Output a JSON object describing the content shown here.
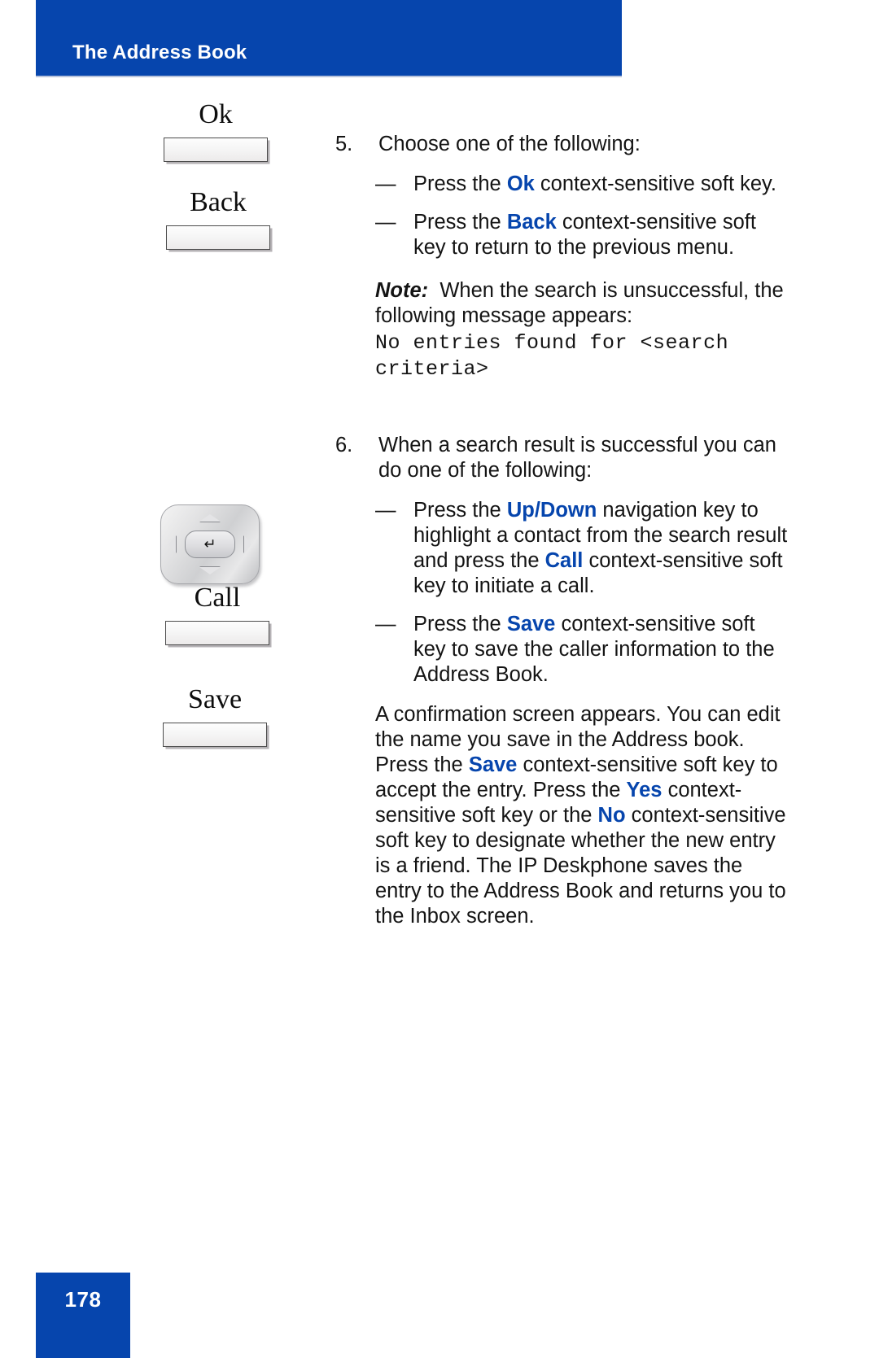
{
  "header": {
    "title": "The Address Book"
  },
  "footer": {
    "page_number": "178"
  },
  "colors": {
    "brand_blue": "#0645AD",
    "keyword_blue": "#0645AD",
    "page_background": "#FFFFFF"
  },
  "graphics": {
    "softkeys": [
      {
        "name": "ok-softkey",
        "label": "Ok"
      },
      {
        "name": "back-softkey",
        "label": "Back"
      },
      {
        "name": "call-softkey",
        "label": "Call"
      },
      {
        "name": "save-softkey",
        "label": "Save"
      }
    ],
    "navigation_cluster": {
      "name": "navigation-key-cluster",
      "enter_glyph": "↵",
      "arrows": [
        "up",
        "down",
        "left",
        "right"
      ]
    }
  },
  "content": {
    "step5": {
      "number": "5.",
      "text": "Choose one of the following:",
      "bullets": [
        {
          "dash": "—",
          "parts": [
            {
              "t": "Press the ",
              "style": "normal"
            },
            {
              "t": "Ok",
              "style": "keyword"
            },
            {
              "t": " context-sensitive soft key.",
              "style": "normal"
            }
          ]
        },
        {
          "dash": "—",
          "parts": [
            {
              "t": "Press the ",
              "style": "normal"
            },
            {
              "t": "Back",
              "style": "keyword"
            },
            {
              "t": " context-sensitive soft key to return to the previous menu.",
              "style": "normal"
            }
          ]
        }
      ],
      "note": {
        "label": "Note:",
        "text": "When the search is unsuccessful, the following message appears:",
        "message": "No entries found for <search criteria>"
      }
    },
    "step6": {
      "number": "6.",
      "text": "When a search result is successful you can do one of the following:",
      "bullets": [
        {
          "dash": "—",
          "parts": [
            {
              "t": "Press the ",
              "style": "normal"
            },
            {
              "t": "Up",
              "style": "keyword"
            },
            {
              "t": "/",
              "style": "keyword"
            },
            {
              "t": "Down",
              "style": "keyword"
            },
            {
              "t": " navigation key to highlight a contact from the search result and press the ",
              "style": "normal"
            },
            {
              "t": "Call",
              "style": "keyword"
            },
            {
              "t": " context-sensitive soft key to initiate a call.",
              "style": "normal"
            }
          ]
        },
        {
          "dash": "—",
          "parts": [
            {
              "t": "Press the ",
              "style": "normal"
            },
            {
              "t": "Save",
              "style": "keyword"
            },
            {
              "t": " context-sensitive soft key to save the caller information to the Address Book.",
              "style": "normal"
            }
          ]
        }
      ],
      "paragraph": [
        {
          "t": "A confirmation screen appears. You can edit the name you save in the Address book. Press the ",
          "style": "normal"
        },
        {
          "t": "Save",
          "style": "keyword"
        },
        {
          "t": " context-sensitive soft key to accept the entry. Press the ",
          "style": "normal"
        },
        {
          "t": "Yes",
          "style": "keyword"
        },
        {
          "t": " context-sensitive soft key or the ",
          "style": "normal"
        },
        {
          "t": "No",
          "style": "keyword"
        },
        {
          "t": " context-sensitive soft key to designate whether the new entry is a friend. The IP Deskphone saves the entry to the Address Book and returns you to the Inbox screen.",
          "style": "normal"
        }
      ]
    }
  }
}
